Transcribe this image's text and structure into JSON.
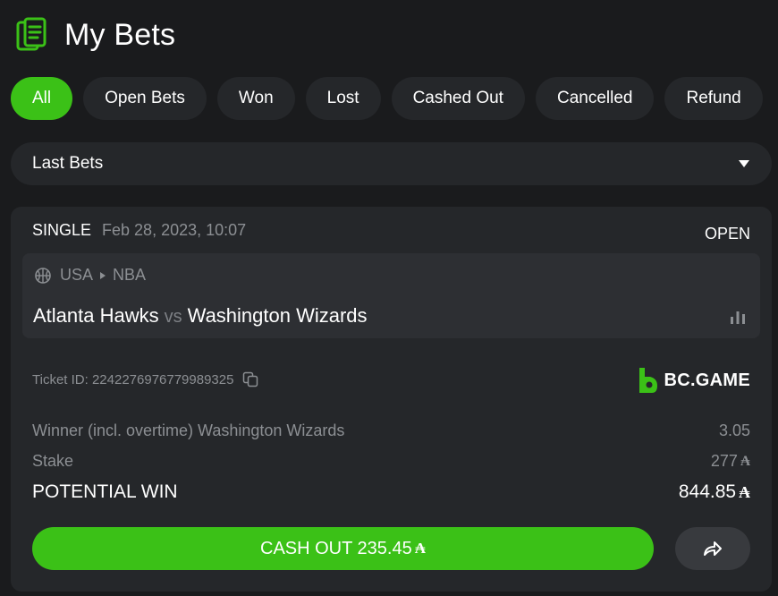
{
  "header": {
    "title": "My Bets",
    "icon": "bet-slip-icon"
  },
  "filters": [
    {
      "label": "All",
      "active": true
    },
    {
      "label": "Open Bets",
      "active": false
    },
    {
      "label": "Won",
      "active": false
    },
    {
      "label": "Lost",
      "active": false
    },
    {
      "label": "Cashed Out",
      "active": false
    },
    {
      "label": "Cancelled",
      "active": false
    },
    {
      "label": "Refund",
      "active": false
    }
  ],
  "dropdown": {
    "selected": "Last Bets",
    "icon": "caret-down-icon"
  },
  "bet": {
    "type": "SINGLE",
    "date": "Feb 28, 2023, 10:07",
    "status": "OPEN",
    "country": "USA",
    "league": "NBA",
    "home": "Atlanta Hawks",
    "vs": "vs",
    "away": "Washington Wizards",
    "ticket_label": "Ticket ID: 2242276976779989325",
    "brand": "BC.GAME",
    "selection": "Winner (incl. overtime) Washington Wizards",
    "odds": "3.05",
    "stake_label": "Stake",
    "stake": "277",
    "potential_label": "POTENTIAL WIN",
    "potential": "844.85",
    "currency_symbol": "₳",
    "cashout_label": "CASH OUT 235.45"
  },
  "colors": {
    "accent": "#3bc117",
    "background": "#1a1b1d",
    "panel": "#25272a",
    "muted": "#8c8f93"
  }
}
